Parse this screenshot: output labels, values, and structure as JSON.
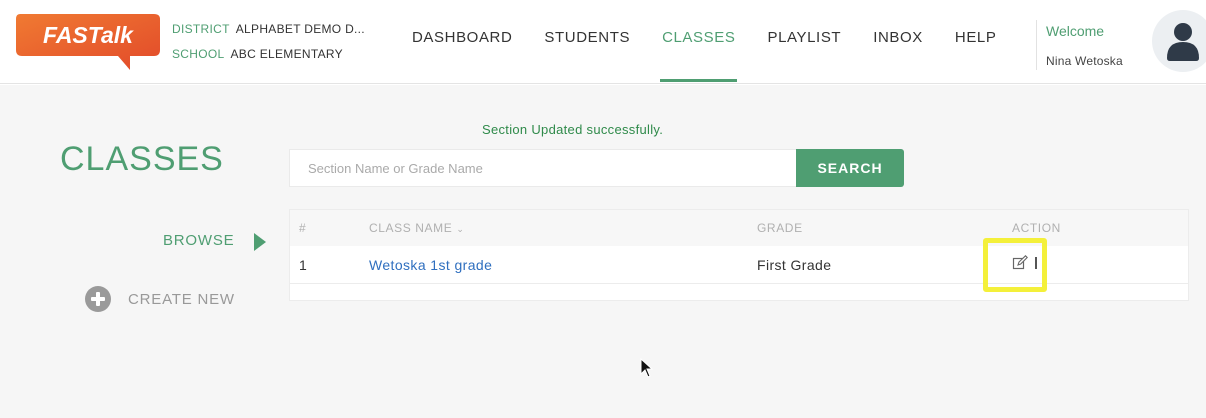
{
  "header": {
    "logo_text": "FASTalk",
    "district_label": "DISTRICT",
    "district_value": "ALPHABET DEMO D...",
    "school_label": "SCHOOL",
    "school_value": "ABC ELEMENTARY",
    "nav": [
      {
        "label": "DASHBOARD"
      },
      {
        "label": "STUDENTS"
      },
      {
        "label": "CLASSES",
        "active": true
      },
      {
        "label": "PLAYLIST"
      },
      {
        "label": "INBOX"
      },
      {
        "label": "HELP"
      }
    ],
    "welcome": "Welcome",
    "user_name": "Nina Wetoska",
    "avatar_icon": "user-avatar-icon"
  },
  "sidebar": {
    "title": "CLASSES",
    "browse_label": "BROWSE",
    "create_label": "CREATE NEW"
  },
  "main": {
    "success_message": "Section Updated successfully.",
    "search": {
      "placeholder": "Section Name or Grade Name",
      "value": "",
      "button_label": "SEARCH"
    },
    "table": {
      "columns": [
        "#",
        "CLASS NAME",
        "GRADE",
        "ACTION"
      ],
      "sort_indicator": "⌄",
      "rows": [
        {
          "num": "1",
          "class_name": "Wetoska 1st grade",
          "grade": "First Grade"
        }
      ]
    }
  },
  "colors": {
    "accent": "#4f9e72",
    "logo_orange": "#ec5f2d",
    "link_blue": "#2f6fbf",
    "highlight_yellow": "#f4f03a"
  }
}
